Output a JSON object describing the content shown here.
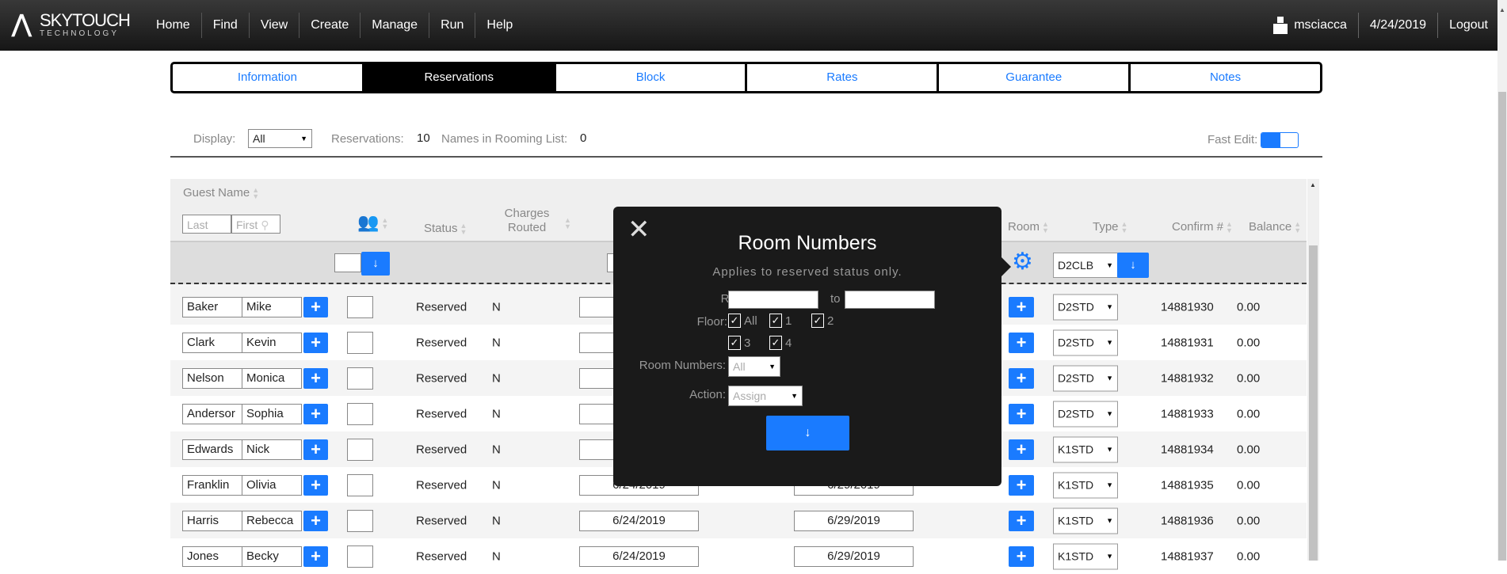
{
  "nav": {
    "logo_main": "SKYTOUCH",
    "logo_sub": "TECHNOLOGY",
    "menu": [
      "Home",
      "Find",
      "View",
      "Create",
      "Manage",
      "Run",
      "Help"
    ],
    "user": "msciacca",
    "date": "4/24/2019",
    "logout": "Logout"
  },
  "tabs": [
    {
      "label": "Information"
    },
    {
      "label": "Reservations",
      "active": true
    },
    {
      "label": "Block"
    },
    {
      "label": "Rates"
    },
    {
      "label": "Guarantee"
    },
    {
      "label": "Notes"
    }
  ],
  "toolbar": {
    "display_label": "Display:",
    "display_value": "All",
    "reservations_label": "Reservations:",
    "reservations_count": "10",
    "rooming_label": "Names in Rooming List:",
    "rooming_count": "0",
    "fast_edit_label": "Fast Edit:",
    "fast_edit_on": true
  },
  "table": {
    "headers": {
      "guest_name": "Guest Name",
      "status": "Status",
      "charges_routed": "Charges Routed",
      "room": "Room",
      "type": "Type",
      "confirm": "Confirm #",
      "balance": "Balance"
    },
    "filter": {
      "last_placeholder": "Last",
      "first_placeholder": "First",
      "type_value": "D2CLB"
    },
    "rows": [
      {
        "last": "Baker",
        "first": "Mike",
        "status": "Reserved",
        "charges": "N",
        "arrival": "",
        "departure": "",
        "type": "D2STD",
        "confirm": "14881930",
        "balance": "0.00"
      },
      {
        "last": "Clark",
        "first": "Kevin",
        "status": "Reserved",
        "charges": "N",
        "arrival": "",
        "departure": "",
        "type": "D2STD",
        "confirm": "14881931",
        "balance": "0.00"
      },
      {
        "last": "Nelson",
        "first": "Monica",
        "status": "Reserved",
        "charges": "N",
        "arrival": "",
        "departure": "",
        "type": "D2STD",
        "confirm": "14881932",
        "balance": "0.00"
      },
      {
        "last": "Andersor",
        "first": "Sophia",
        "status": "Reserved",
        "charges": "N",
        "arrival": "",
        "departure": "",
        "type": "D2STD",
        "confirm": "14881933",
        "balance": "0.00"
      },
      {
        "last": "Edwards",
        "first": "Nick",
        "status": "Reserved",
        "charges": "N",
        "arrival": "",
        "departure": "",
        "type": "K1STD",
        "confirm": "14881934",
        "balance": "0.00"
      },
      {
        "last": "Franklin",
        "first": "Olivia",
        "status": "Reserved",
        "charges": "N",
        "arrival": "6/24/2019",
        "departure": "6/29/2019",
        "type": "K1STD",
        "confirm": "14881935",
        "balance": "0.00"
      },
      {
        "last": "Harris",
        "first": "Rebecca",
        "status": "Reserved",
        "charges": "N",
        "arrival": "6/24/2019",
        "departure": "6/29/2019",
        "type": "K1STD",
        "confirm": "14881936",
        "balance": "0.00"
      },
      {
        "last": "Jones",
        "first": "Becky",
        "status": "Reserved",
        "charges": "N",
        "arrival": "6/24/2019",
        "departure": "6/29/2019",
        "type": "K1STD",
        "confirm": "14881937",
        "balance": "0.00"
      }
    ]
  },
  "modal": {
    "title": "Room Numbers",
    "subtitle": "Applies to reserved status only.",
    "range_label": "Range:",
    "to_label": "to",
    "range_from": "",
    "range_to": "",
    "floor_label": "Floor:",
    "floors": [
      {
        "label": "All",
        "checked": true
      },
      {
        "label": "1",
        "checked": true
      },
      {
        "label": "2",
        "checked": true
      },
      {
        "label": "3",
        "checked": true
      },
      {
        "label": "4",
        "checked": true
      }
    ],
    "room_numbers_label": "Room Numbers:",
    "room_numbers_value": "All",
    "action_label": "Action:",
    "action_value": "Assign"
  },
  "colors": {
    "accent": "#1a7bff",
    "navbar": "#1e1e1e",
    "modal": "#1a1a1a"
  }
}
